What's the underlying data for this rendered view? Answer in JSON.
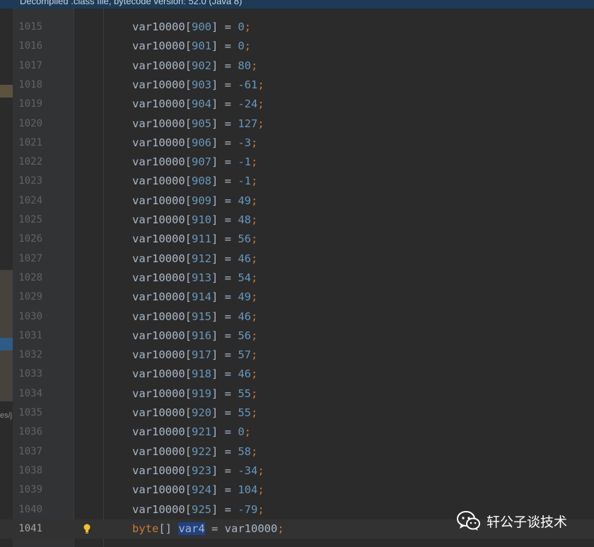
{
  "banner_text": "Decompiled .class file, bytecode version: 52.0 (Java 8)",
  "left_strip_text": "es/j",
  "code": {
    "array_name": "var10000",
    "lines": [
      {
        "line": "1015",
        "index": "900",
        "value": "0"
      },
      {
        "line": "1016",
        "index": "901",
        "value": "0"
      },
      {
        "line": "1017",
        "index": "902",
        "value": "80"
      },
      {
        "line": "1018",
        "index": "903",
        "value": "-61"
      },
      {
        "line": "1019",
        "index": "904",
        "value": "-24"
      },
      {
        "line": "1020",
        "index": "905",
        "value": "127"
      },
      {
        "line": "1021",
        "index": "906",
        "value": "-3"
      },
      {
        "line": "1022",
        "index": "907",
        "value": "-1"
      },
      {
        "line": "1023",
        "index": "908",
        "value": "-1"
      },
      {
        "line": "1024",
        "index": "909",
        "value": "49"
      },
      {
        "line": "1025",
        "index": "910",
        "value": "48"
      },
      {
        "line": "1026",
        "index": "911",
        "value": "56"
      },
      {
        "line": "1027",
        "index": "912",
        "value": "46"
      },
      {
        "line": "1028",
        "index": "913",
        "value": "54"
      },
      {
        "line": "1029",
        "index": "914",
        "value": "49"
      },
      {
        "line": "1030",
        "index": "915",
        "value": "46"
      },
      {
        "line": "1031",
        "index": "916",
        "value": "56"
      },
      {
        "line": "1032",
        "index": "917",
        "value": "57"
      },
      {
        "line": "1033",
        "index": "918",
        "value": "46"
      },
      {
        "line": "1034",
        "index": "919",
        "value": "55"
      },
      {
        "line": "1035",
        "index": "920",
        "value": "55"
      },
      {
        "line": "1036",
        "index": "921",
        "value": "0"
      },
      {
        "line": "1037",
        "index": "922",
        "value": "58"
      },
      {
        "line": "1038",
        "index": "923",
        "value": "-34"
      },
      {
        "line": "1039",
        "index": "924",
        "value": "104"
      },
      {
        "line": "1040",
        "index": "925",
        "value": "-79"
      }
    ],
    "last_line": {
      "line": "1041",
      "type_keyword": "byte",
      "brackets": "[]",
      "variable": "var4",
      "assign": " = ",
      "source": "var10000",
      "semicolon": ";"
    },
    "syntax": {
      "open_bracket": "[",
      "close_bracket": "] = ",
      "semicolon": ";"
    }
  },
  "watermark": {
    "text": "轩公子谈技术",
    "icon": "wechat-icon"
  },
  "intention_icon": "lightbulb-icon",
  "colors": {
    "background": "#2b2b2b",
    "gutter": "#313335",
    "number": "#6897bb",
    "keyword": "#cc7832",
    "identifier": "#a9b7c6",
    "selection": "#214283"
  }
}
